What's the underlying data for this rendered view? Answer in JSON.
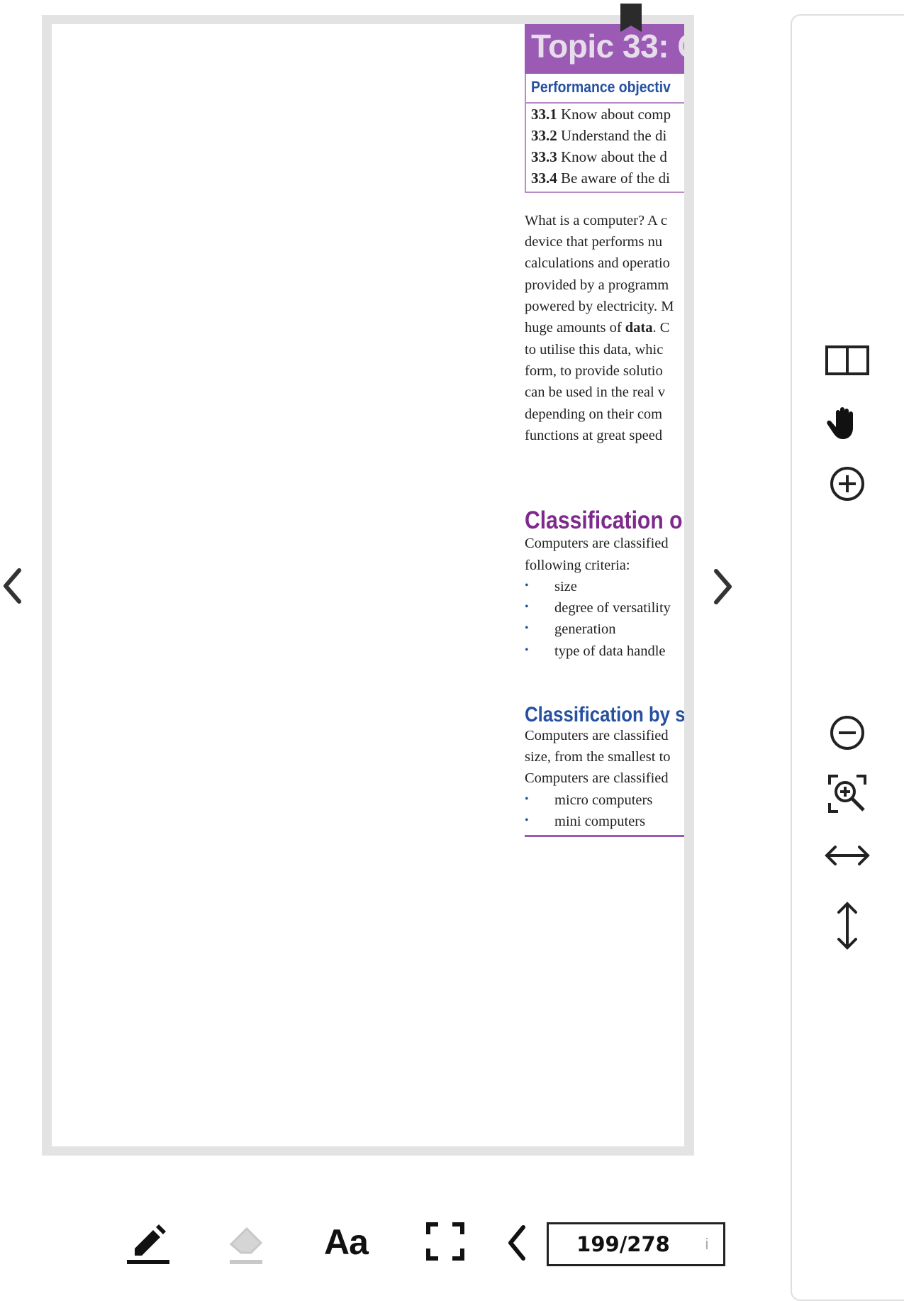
{
  "document": {
    "topic_title": "Topic 33: C",
    "objectives_heading": "Performance objectiv",
    "objectives": [
      {
        "num": "33.1",
        "text": "Know about comp"
      },
      {
        "num": "33.2",
        "text": "Understand the di"
      },
      {
        "num": "33.3",
        "text": "Know about the d"
      },
      {
        "num": "33.4",
        "text": "Be aware of the di"
      }
    ],
    "intro_lines": [
      "What is a computer? A c",
      "device that performs nu",
      "calculations and operatio",
      "provided by a programm",
      "powered by electricity. M",
      "huge amounts of ",
      "to utilise this data, whic",
      "form, to provide solutio",
      "can be used in the real v",
      "depending on their com",
      "functions at great speed"
    ],
    "intro_bold_word": "data",
    "intro_after_bold": ". C",
    "section1_heading": "Classification o",
    "section1_lines": [
      "Computers are classified",
      "following criteria:"
    ],
    "section1_bullets": [
      "size",
      "degree of versatility",
      "generation",
      "type of data handle"
    ],
    "section2_heading": "Classification by s",
    "section2_lines": [
      "Computers are classified",
      "size, from the smallest to",
      "Computers are classified"
    ],
    "section2_bullets": [
      "micro computers",
      "mini computers"
    ],
    "bullet_symbol": "•"
  },
  "side_toolbar": {
    "tools": [
      "two-page-view-icon",
      "pan-hand-icon",
      "zoom-in-icon",
      "zoom-out-icon",
      "zoom-selection-icon",
      "fit-width-icon",
      "fit-height-icon"
    ]
  },
  "bottom_toolbar": {
    "font_button_label": "Aa",
    "page_indicator": "199/278",
    "info_label": "i"
  },
  "colors": {
    "topic_band": "#9b5bb5",
    "heading_purple": "#7e2a8c",
    "heading_blue": "#2650a0",
    "frame_gray": "#e3e3e3"
  }
}
